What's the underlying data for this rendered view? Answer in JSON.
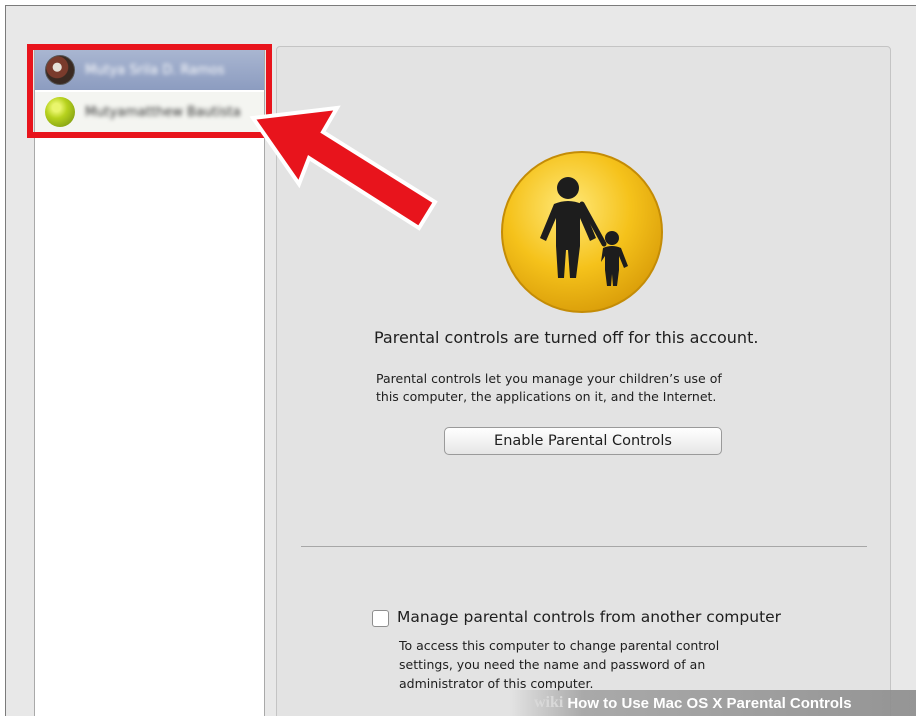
{
  "users": [
    {
      "name": "Mutya Srila D. Ramos",
      "selected": true
    },
    {
      "name": "Mutyamatthew Bautista",
      "selected": false
    }
  ],
  "panel": {
    "headline": "Parental controls are turned off for this account.",
    "description_line1": "Parental controls let you manage your children’s use of",
    "description_line2": "this computer, the applications on it, and the Internet.",
    "enable_button": "Enable Parental Controls",
    "remote": {
      "checkbox_label": "Manage parental controls from another computer",
      "checked": false,
      "desc_line1": "To access this computer to change parental control",
      "desc_line2": "settings, you need the name and password of an",
      "desc_line3": "administrator of this computer."
    }
  },
  "icons": {
    "parental_controls": "parental-controls-icon",
    "annotation_arrow": "arrow-icon"
  },
  "colors": {
    "highlight": "#e8141c",
    "selection": "#8c9cc0",
    "icon_yellow": "#f5c21b"
  },
  "watermark": {
    "brand": "wiki",
    "title": "How to Use Mac OS X Parental Controls"
  }
}
